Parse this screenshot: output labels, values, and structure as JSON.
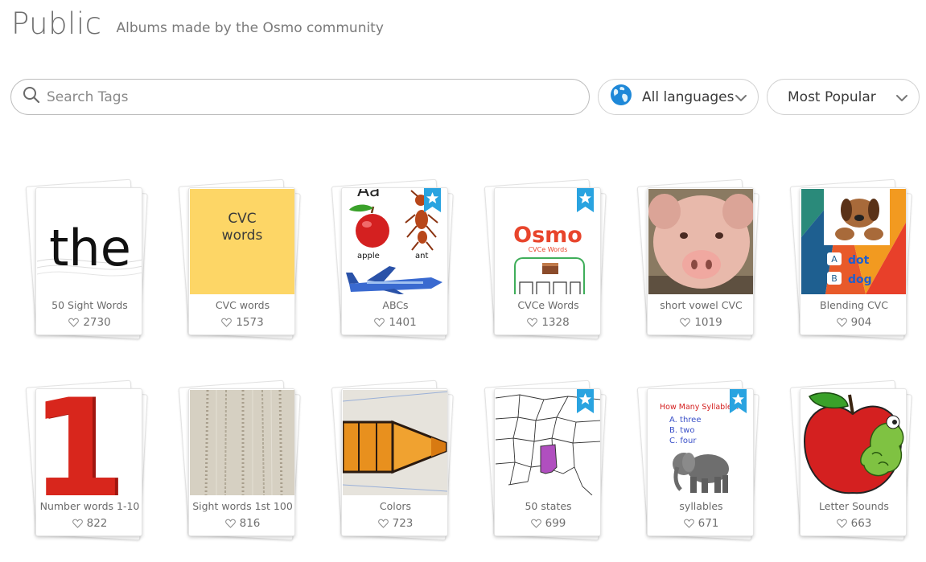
{
  "header": {
    "title": "Public",
    "subtitle": "Albums made by the Osmo community"
  },
  "search": {
    "placeholder": "Search Tags",
    "value": ""
  },
  "filters": {
    "language": "All languages",
    "sort": "Most Popular"
  },
  "thumb_text": {
    "the": "the",
    "cvc_line1": "CVC",
    "cvc_line2": "words",
    "abc_top": "Aa",
    "apple": "apple",
    "ant": "ant",
    "osmo": "Osmo",
    "cvce": "CVCe Words",
    "dot": "dot",
    "dog": "dog",
    "a": "A",
    "b": "B",
    "one": "1",
    "syll_title": "How Many Syllables?",
    "syll_a": "A.  three",
    "syll_b": "B.  two",
    "syll_c": "C.  four"
  },
  "albums": [
    {
      "name": "50 Sight Words",
      "likes": "2730",
      "featured": false
    },
    {
      "name": "CVC words",
      "likes": "1573",
      "featured": false
    },
    {
      "name": "ABCs",
      "likes": "1401",
      "featured": true
    },
    {
      "name": "CVCe Words",
      "likes": "1328",
      "featured": true
    },
    {
      "name": "short vowel CVC",
      "likes": "1019",
      "featured": false
    },
    {
      "name": "Blending CVC",
      "likes": "904",
      "featured": false
    },
    {
      "name": "Number words 1-10",
      "likes": "822",
      "featured": false
    },
    {
      "name": "Sight words 1st 100",
      "likes": "816",
      "featured": false
    },
    {
      "name": "Colors",
      "likes": "723",
      "featured": false
    },
    {
      "name": "50 states",
      "likes": "699",
      "featured": true
    },
    {
      "name": "syllables",
      "likes": "671",
      "featured": true
    },
    {
      "name": "Letter Sounds",
      "likes": "663",
      "featured": false
    }
  ],
  "colors": {
    "cvc_yellow": "#fdd666",
    "badge_blue": "#29a3e0",
    "apple_red": "#d42020",
    "number_red": "#d8261c"
  },
  "icons": {
    "search": "search-icon",
    "language": "globe-icon",
    "dropdown": "chevron-down-icon",
    "likes": "heart-icon",
    "featured": "star-ribbon-icon"
  }
}
